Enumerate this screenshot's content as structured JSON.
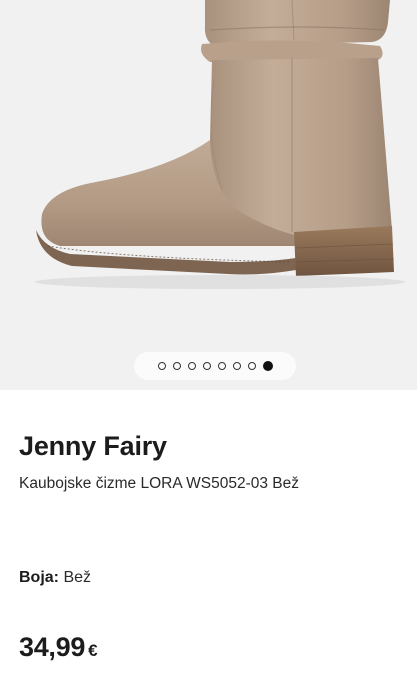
{
  "gallery": {
    "image_icon": "boot-product-image",
    "dot_count": 8,
    "active_index": 7
  },
  "product": {
    "brand": "Jenny Fairy",
    "name": "Kaubojske čizme LORA WS5052-03 Bež",
    "color_label": "Boja:",
    "color_value": "Bež",
    "price_amount": "34,99",
    "price_currency": "€"
  }
}
